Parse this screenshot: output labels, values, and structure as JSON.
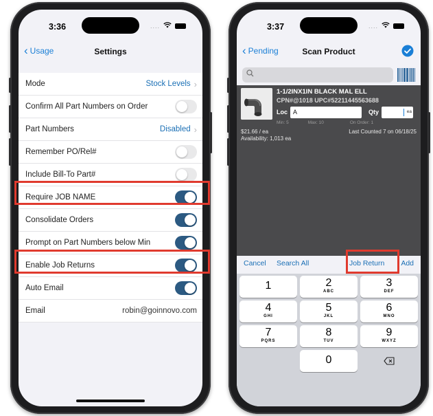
{
  "colors": {
    "accent": "#1a6fb5",
    "highlight": "#e03a2e",
    "toggle_on": "#2c5a82"
  },
  "left_phone": {
    "status": {
      "time": "3:36",
      "signal": "....",
      "wifi_icon": "wifi-icon",
      "battery_icon": "battery-icon"
    },
    "nav": {
      "back_label": "Usage",
      "title": "Settings"
    },
    "rows": [
      {
        "label": "Mode",
        "value": "Stock Levels",
        "type": "link"
      },
      {
        "label": "Confirm All Part Numbers on Order",
        "type": "toggle",
        "on": false
      },
      {
        "label": "Part Numbers",
        "value": "Disabled",
        "type": "link"
      },
      {
        "label": "Remember PO/Rel#",
        "type": "toggle",
        "on": false
      },
      {
        "label": "Include Bill-To Part#",
        "type": "toggle",
        "on": false
      },
      {
        "label": "Require JOB NAME",
        "type": "toggle",
        "on": true,
        "highlighted": true
      },
      {
        "label": "Consolidate Orders",
        "type": "toggle",
        "on": true
      },
      {
        "label": "Prompt on Part Numbers below Min",
        "type": "toggle",
        "on": true
      },
      {
        "label": "Enable Job Returns",
        "type": "toggle",
        "on": true,
        "highlighted": true
      },
      {
        "label": "Auto Email",
        "type": "toggle",
        "on": true
      },
      {
        "label": "Email",
        "value": "robin@goinnovo.com",
        "type": "text"
      }
    ]
  },
  "right_phone": {
    "status": {
      "time": "3:37",
      "signal": "....",
      "wifi_icon": "wifi-icon",
      "battery_icon": "battery-icon"
    },
    "nav": {
      "back_label": "Pending",
      "title": "Scan Product",
      "check_icon": "checkmark-circle-icon"
    },
    "search": {
      "placeholder": "",
      "icon": "search-icon",
      "barcode_icon": "barcode-icon"
    },
    "product": {
      "name": "1-1/2INX1IN BLACK MAL ELL",
      "codes": "CPN#@1018 UPC#52211445563688",
      "loc_label": "Loc",
      "loc_value": "A",
      "qty_label": "Qty",
      "qty_unit": "ea",
      "min": "Min: 5",
      "max": "Max: 10",
      "on_order": "On Order: 1",
      "price": "$21.66 / ea",
      "availability": "Availability: 1,013 ea",
      "last_counted": "Last Counted 7 on 06/18/25"
    },
    "actions": {
      "cancel": "Cancel",
      "search_all": "Search All",
      "job_return": "Job Return",
      "add": "Add"
    },
    "keypad": [
      [
        {
          "num": "1",
          "letters": ""
        },
        {
          "num": "2",
          "letters": "ABC"
        },
        {
          "num": "3",
          "letters": "DEF"
        }
      ],
      [
        {
          "num": "4",
          "letters": "GHI"
        },
        {
          "num": "5",
          "letters": "JKL"
        },
        {
          "num": "6",
          "letters": "MNO"
        }
      ],
      [
        {
          "num": "7",
          "letters": "PQRS"
        },
        {
          "num": "8",
          "letters": "TUV"
        },
        {
          "num": "9",
          "letters": "WXYZ"
        }
      ],
      [
        {
          "num": "",
          "letters": ""
        },
        {
          "num": "0",
          "letters": ""
        },
        {
          "num": "",
          "letters": "",
          "icon": "delete-icon"
        }
      ]
    ]
  }
}
